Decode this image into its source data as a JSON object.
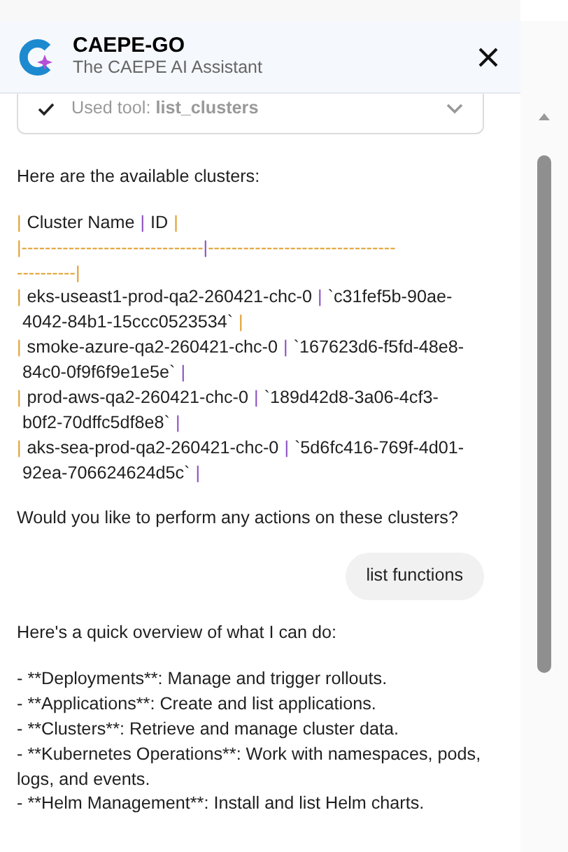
{
  "header": {
    "title": "CAEPE-GO",
    "subtitle": "The CAEPE AI Assistant"
  },
  "tool_card": {
    "label": "Used tool: ",
    "tool": "list_clusters",
    "expanded": false
  },
  "messages": [
    {
      "kind": "bot",
      "paragraphs": [
        {
          "kind": "text",
          "lines": [
            "Here are the available clusters:"
          ]
        },
        {
          "kind": "table",
          "lines": [
            [
              {
                "kind": "pipe",
                "text": "|",
                "color": "#e0a030"
              },
              {
                "kind": "text",
                "text": " Cluster Name "
              },
              {
                "kind": "pipe",
                "text": "|",
                "color": "#8a4fbf"
              },
              {
                "kind": "text",
                "text": " ID "
              },
              {
                "kind": "pipe",
                "text": "|",
                "color": "#e0a030"
              }
            ],
            [
              {
                "kind": "pipe",
                "text": "|",
                "color": "#e0a030"
              },
              {
                "kind": "pipe",
                "text": "-------------------------------",
                "color": "#e0a030"
              },
              {
                "kind": "pipe",
                "text": "|",
                "color": "#8a4fbf"
              },
              {
                "kind": "pipe",
                "text": "--------------------------------",
                "color": "#e0a030"
              }
            ],
            [
              {
                "kind": "pipe",
                "text": "----------",
                "color": "#e0a030"
              },
              {
                "kind": "pipe",
                "text": "|",
                "color": "#e0a030"
              }
            ],
            [
              {
                "kind": "pipe",
                "text": "|",
                "color": "#e0a030"
              },
              {
                "kind": "text",
                "text": "eks-useast1-prod-qa2-260421-chc-0"
              },
              {
                "kind": "pipe",
                "text": "|",
                "color": "#8a4fbf"
              },
              {
                "kind": "text",
                "text": "`c31fef5b-90ae-"
              }
            ],
            [
              {
                "kind": "text",
                "text": "4042-84b1-15ccc0523534`"
              },
              {
                "kind": "pipe",
                "text": "|",
                "color": "#e0a030"
              }
            ],
            [
              {
                "kind": "pipe",
                "text": "|",
                "color": "#e0a030"
              },
              {
                "kind": "text",
                "text": "smoke-azure-qa2-260421-chc-0"
              },
              {
                "kind": "pipe",
                "text": "|",
                "color": "#8a4fbf"
              },
              {
                "kind": "text",
                "text": "`167623d6-f5fd-48e8-"
              }
            ],
            [
              {
                "kind": "text",
                "text": "84c0-0f9f6f9e1e5e`"
              },
              {
                "kind": "pipe",
                "text": "|",
                "color": "#8a4fbf"
              }
            ],
            [
              {
                "kind": "pipe",
                "text": "|",
                "color": "#e0a030"
              },
              {
                "kind": "text",
                "text": "prod-aws-qa2-260421-chc-0"
              },
              {
                "kind": "pipe",
                "text": "|",
                "color": "#8a4fbf"
              },
              {
                "kind": "text",
                "text": "`189d42d8-3a06-4cf3-"
              }
            ],
            [
              {
                "kind": "text",
                "text": "b0f2-70dffc5df8e8`"
              },
              {
                "kind": "pipe",
                "text": "|",
                "color": "#8a4fbf"
              }
            ],
            [
              {
                "kind": "pipe",
                "text": "|",
                "color": "#e0a030"
              },
              {
                "kind": "text",
                "text": "aks-sea-prod-qa2-260421-chc-0"
              },
              {
                "kind": "pipe",
                "text": "|",
                "color": "#8a4fbf"
              },
              {
                "kind": "text",
                "text": "`5d6fc416-769f-4d01-"
              }
            ],
            [
              {
                "kind": "text",
                "text": "92ea-706624624d5c`"
              },
              {
                "kind": "pipe",
                "text": "|",
                "color": "#8a4fbf"
              }
            ]
          ]
        },
        {
          "kind": "text",
          "lines": [
            "Would you like to perform any actions on these clusters?"
          ]
        }
      ]
    },
    {
      "kind": "user",
      "text": "list functions"
    },
    {
      "kind": "bot",
      "paragraphs": [
        {
          "kind": "text",
          "lines": [
            "Here's a quick overview of what I can do:"
          ]
        },
        {
          "kind": "text",
          "lines": [
            "- **Deployments**: Manage and trigger rollouts.",
            "- **Applications**: Create and list applications.",
            "- **Clusters**: Retrieve and manage cluster data.",
            "- **Kubernetes Operations**: Work with namespaces, pods, logs, and events.",
            "- **Helm Management**: Install and list Helm charts."
          ]
        }
      ]
    }
  ]
}
